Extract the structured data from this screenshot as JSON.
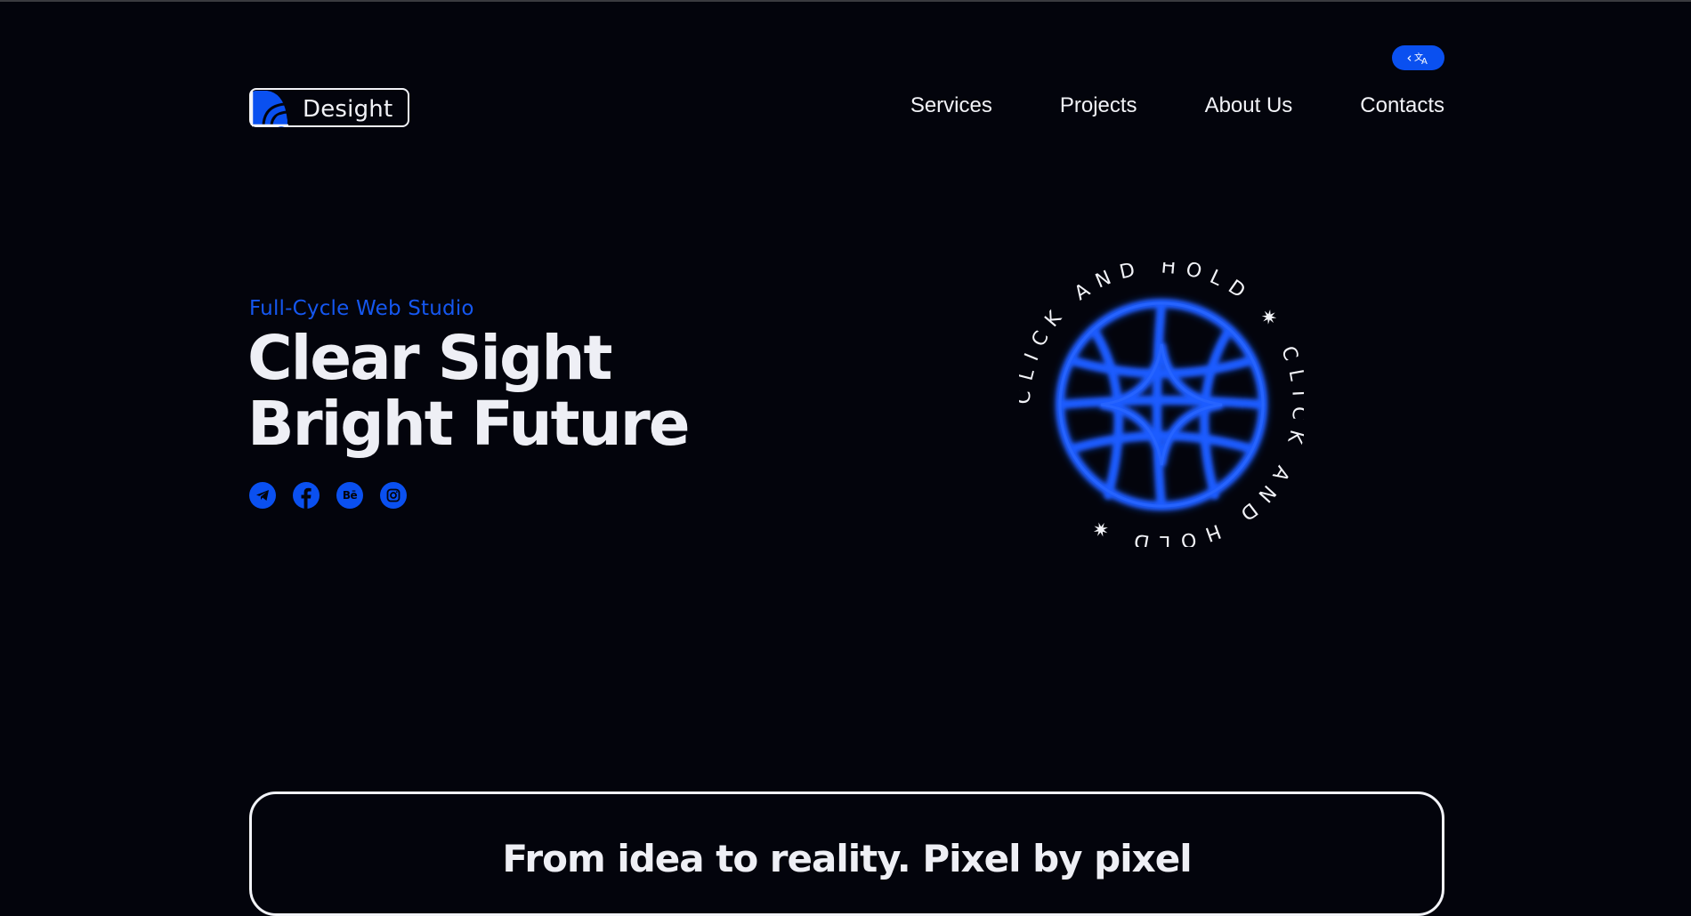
{
  "language": {
    "toggle_icon": "translate-icon",
    "chevron": "‹"
  },
  "brand": {
    "name": "Desight",
    "logo_icon": "desight-logo-mark",
    "accent": "#0a50f0"
  },
  "nav": {
    "items": [
      {
        "label": "Services"
      },
      {
        "label": "Projects"
      },
      {
        "label": "About Us"
      },
      {
        "label": "Contacts"
      }
    ]
  },
  "hero": {
    "kicker": "Full-Cycle Web Studio",
    "headline_line1": "Clear Sight",
    "headline_line2": "Bright Future",
    "socials": [
      {
        "icon": "telegram-icon"
      },
      {
        "icon": "facebook-icon"
      },
      {
        "icon": "behance-icon",
        "text": "Bē"
      },
      {
        "icon": "instagram-icon"
      }
    ]
  },
  "globe": {
    "ring_text": "CLICK AND HOLD ✷ CLICK AND HOLD ✷ ",
    "icon": "globe-icon"
  },
  "section": {
    "title": "From idea to reality. Pixel by pixel"
  },
  "colors": {
    "background": "#03040c",
    "text": "#f2f3f8",
    "accent": "#0a50f0"
  }
}
